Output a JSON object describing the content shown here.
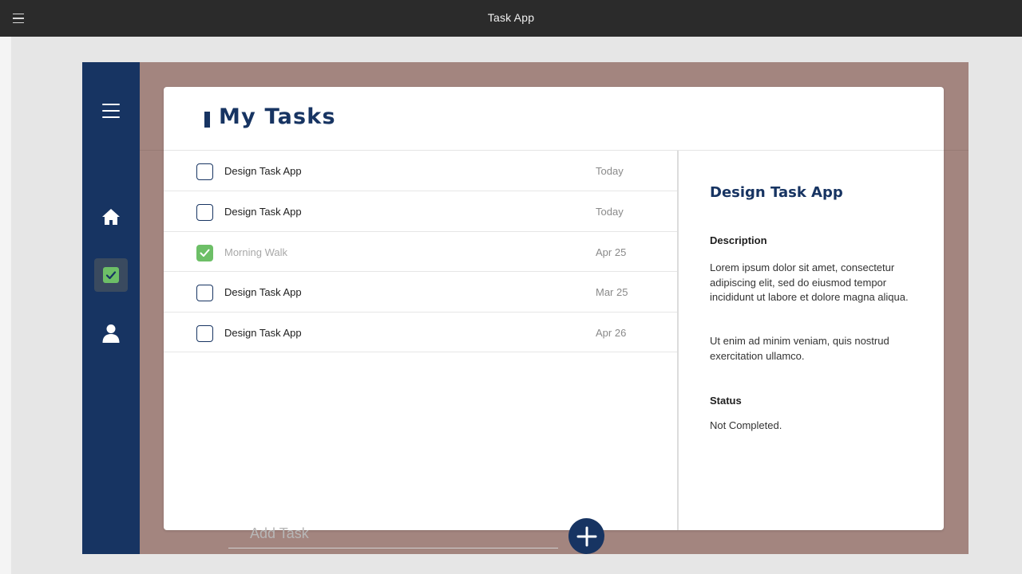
{
  "window": {
    "title": "Task App"
  },
  "page": {
    "title": "My Tasks"
  },
  "tasks": [
    {
      "name": "Design Task  App",
      "date": "Today",
      "done": false
    },
    {
      "name": "Design Task  App",
      "date": "Today",
      "done": false
    },
    {
      "name": "Morning Walk",
      "date": "Apr 25",
      "done": true
    },
    {
      "name": "Design Task  App",
      "date": "Mar 25",
      "done": false
    },
    {
      "name": "Design Task  App",
      "date": "Apr 26",
      "done": false
    }
  ],
  "add_task": {
    "placeholder": "Add Task"
  },
  "detail": {
    "title": "Design Task App",
    "description_label": "Description",
    "description_p1": "Lorem ipsum dolor sit amet, consectetur adipiscing elit, sed do eiusmod tempor incididunt ut labore et dolore magna aliqua.",
    "description_p2": "Ut enim ad minim veniam, quis nostrud exercitation ullamco.",
    "status_label": "Status",
    "status_value": "Not Completed."
  },
  "sidebar": {
    "items": [
      {
        "icon": "home-icon"
      },
      {
        "icon": "task-check-icon",
        "active": true
      },
      {
        "icon": "user-icon"
      }
    ]
  },
  "colors": {
    "navy": "#173462",
    "frame": "#a3857f",
    "check_green": "#6dbf67",
    "titlebar": "#2b2b2b"
  }
}
